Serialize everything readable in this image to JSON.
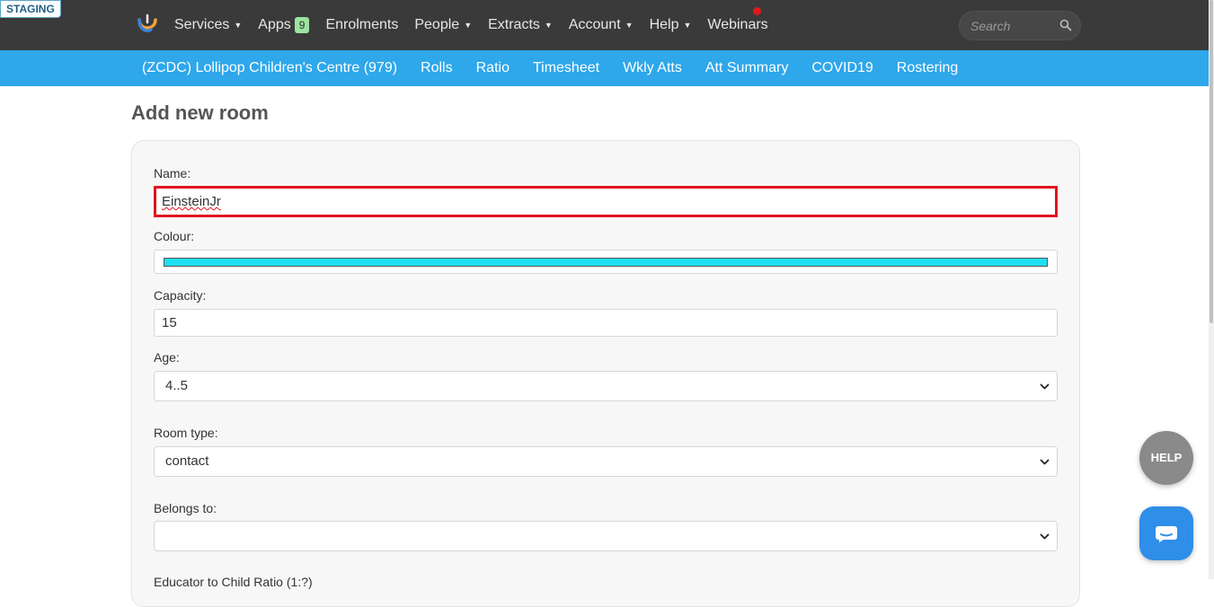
{
  "staging_badge": "STAGING",
  "topnav": {
    "items": [
      {
        "label": "Services",
        "caret": true
      },
      {
        "label": "Apps",
        "badge": "9"
      },
      {
        "label": "Enrolments"
      },
      {
        "label": "People",
        "caret": true
      },
      {
        "label": "Extracts",
        "caret": true
      },
      {
        "label": "Account",
        "caret": true
      },
      {
        "label": "Help",
        "caret": true
      },
      {
        "label": "Webinars"
      }
    ],
    "search_placeholder": "Search"
  },
  "subnav": {
    "items": [
      "(ZCDC) Lollipop Children's Centre (979)",
      "Rolls",
      "Ratio",
      "Timesheet",
      "Wkly Atts",
      "Att Summary",
      "COVID19",
      "Rostering"
    ]
  },
  "page": {
    "title": "Add new room"
  },
  "form": {
    "name_label": "Name:",
    "name_value": "EinsteinJr",
    "colour_label": "Colour:",
    "colour_value": "#1ee0f0",
    "capacity_label": "Capacity:",
    "capacity_value": "15",
    "age_label": "Age:",
    "age_value": "4..5",
    "room_type_label": "Room type:",
    "room_type_value": "contact",
    "belongs_to_label": "Belongs to:",
    "belongs_to_value": "",
    "ratio_label": "Educator to Child Ratio (1:?)"
  },
  "help_button": "HELP",
  "colors": {
    "topbar": "#3a3a3a",
    "subbar": "#2ea7eb",
    "highlight": "#e0141e"
  }
}
